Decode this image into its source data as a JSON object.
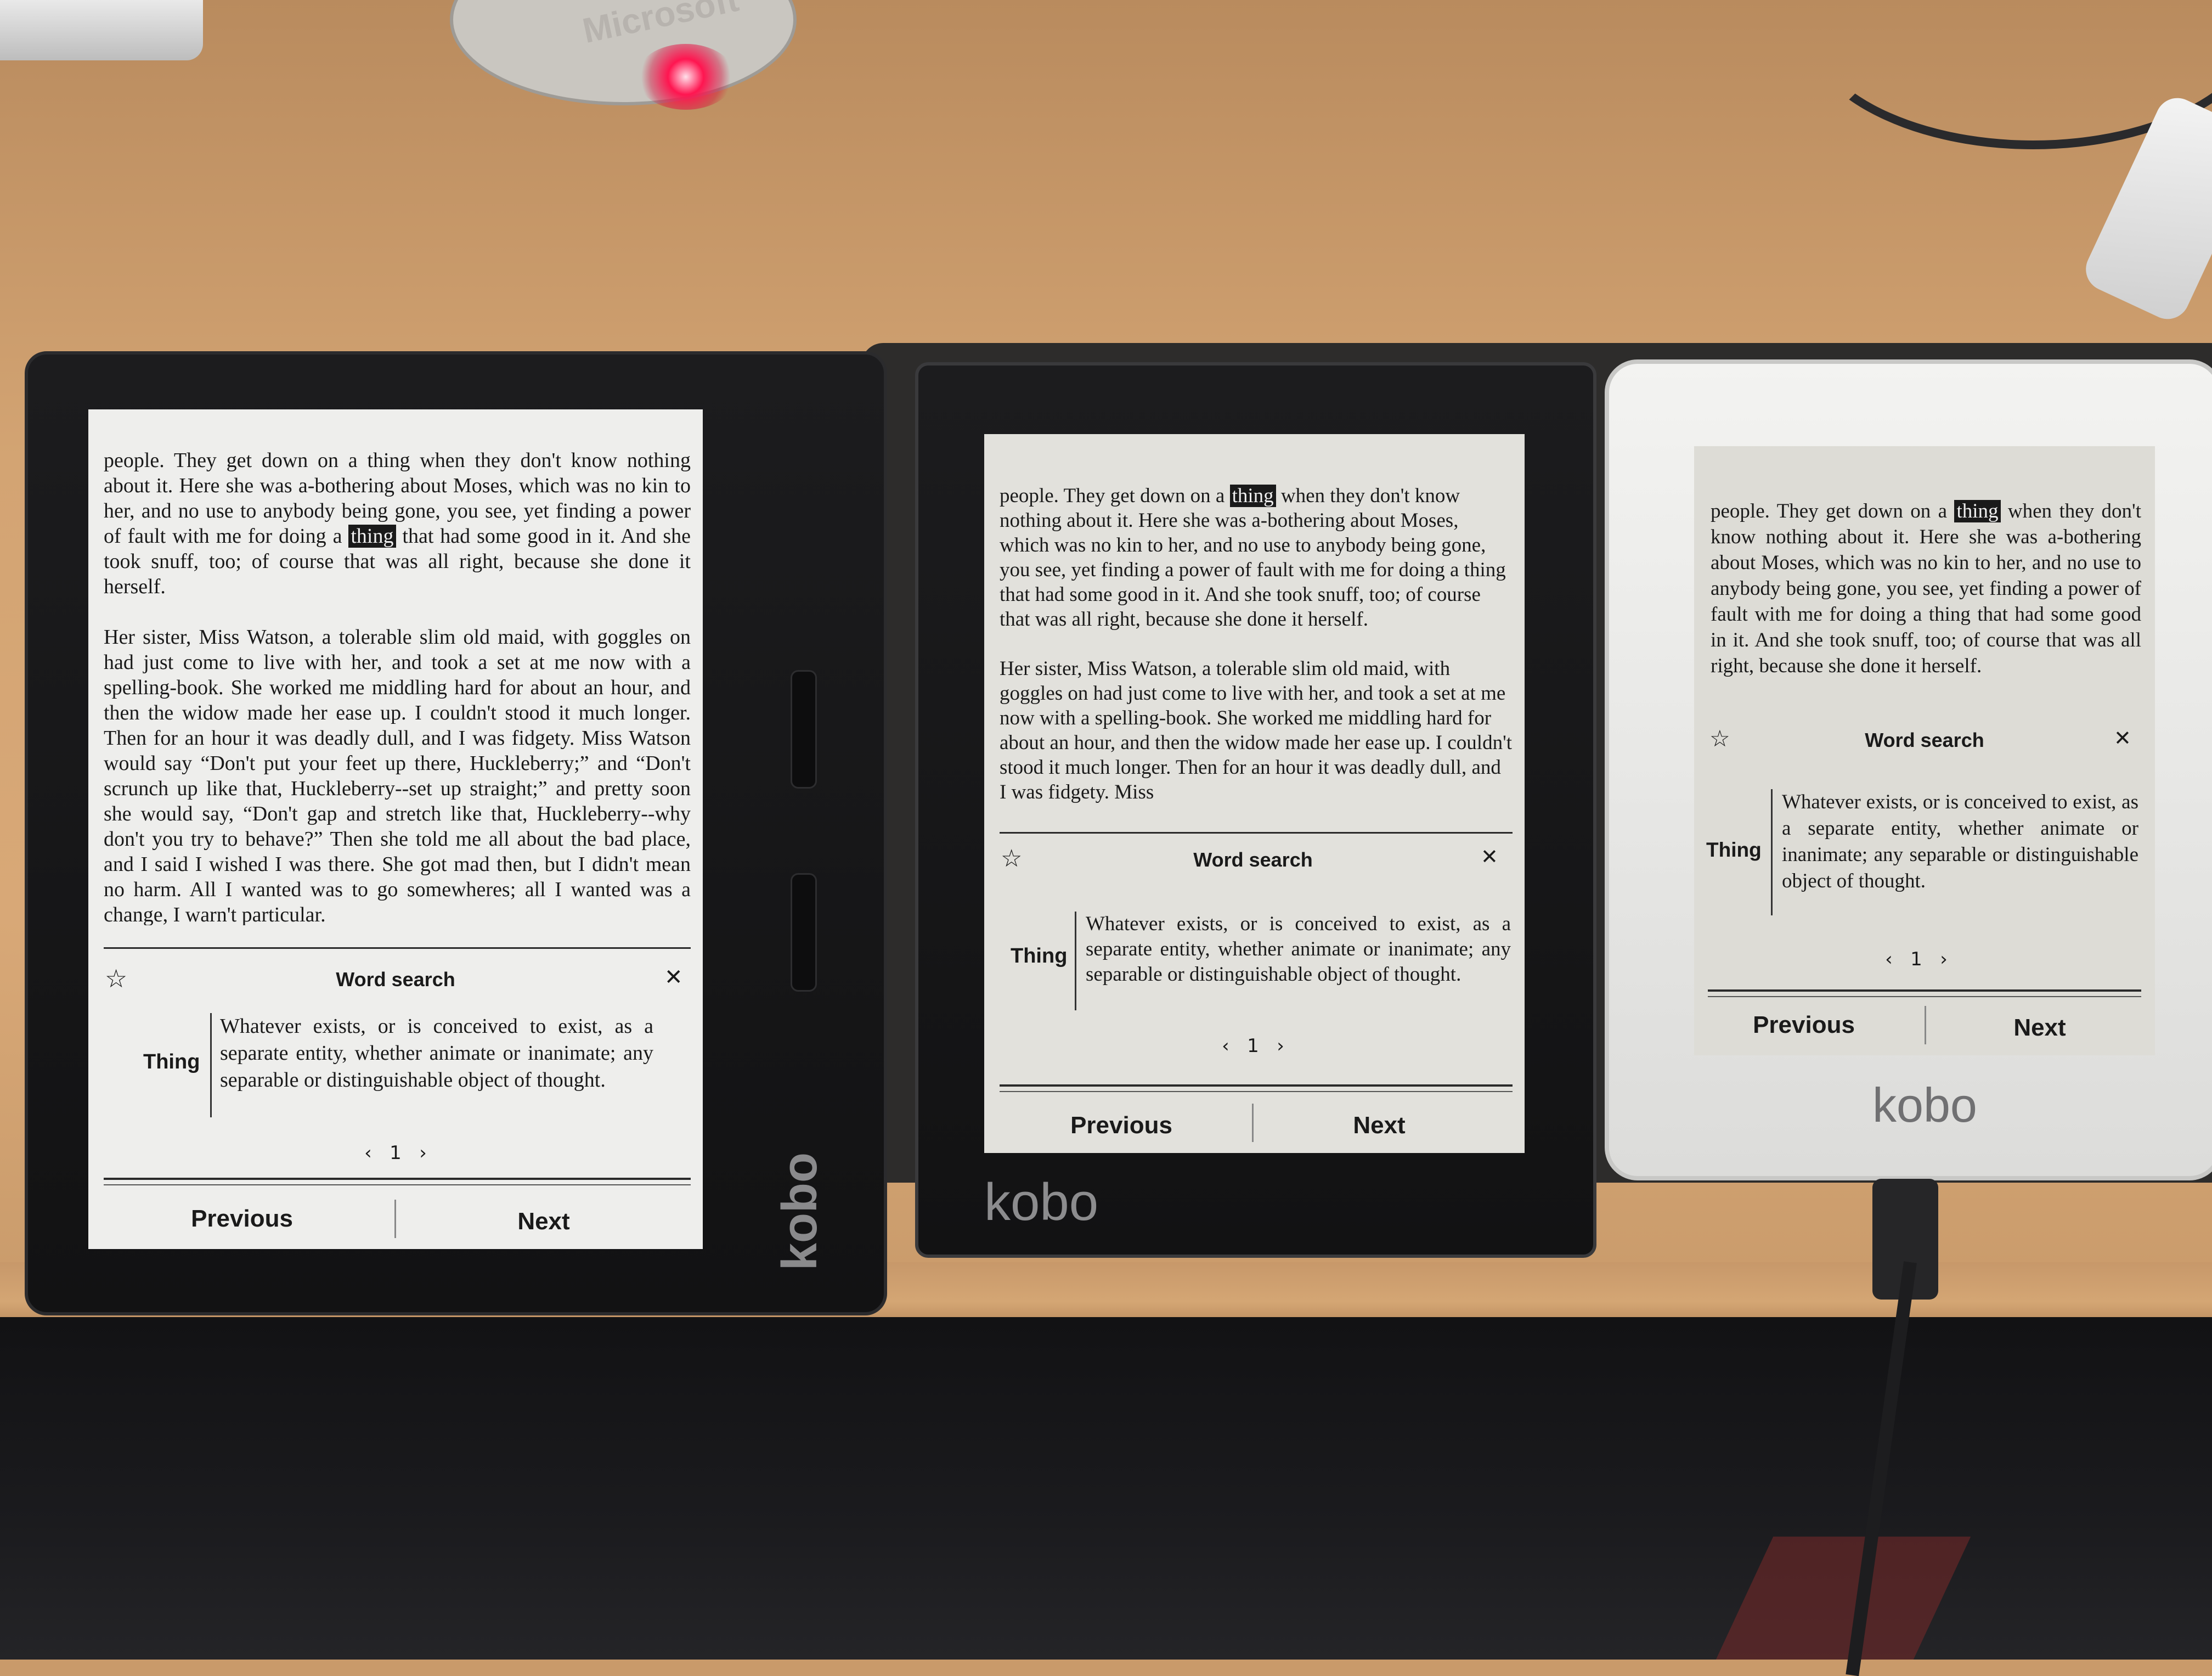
{
  "scene": {
    "mouse_brand": "Microsoft"
  },
  "devices": [
    {
      "logo": "kobo",
      "text_p1_before": "people. They get down on a thing when they don't know nothing about it. Here she was a-bothering about Moses, which was no kin to her, and no use to anybody being gone, you see, yet finding a power of fault with me for doing a ",
      "text_p1_highlight": "thing",
      "text_p1_after": " that had some good in it. And she took snuff, too; of course that was all right, because she done it herself.",
      "text_p2": "Her sister, Miss Watson, a tolerable slim old maid, with goggles on had just come to live with her, and took a set at me now with a spelling-book. She worked me middling hard for about an hour, and then the widow made her ease up. I couldn't stood it much longer. Then for an hour it was deadly dull, and I was fidgety. Miss Watson would say “Don't put your feet up there, Huckleberry;” and “Don't scrunch up like that, Huckleberry--set up straight;” and pretty soon she would say, “Don't gap and stretch like that, Huckleberry--why don't you try to behave?” Then she told me all about the bad place, and I said I wished I was there. She got mad then, but I didn't mean no harm. All I wanted was to go somewheres; all I wanted was a change, I warn't particular.",
      "word_search": {
        "title": "Word search",
        "star_icon": "☆",
        "close_icon": "✕",
        "term": "Thing",
        "definition": "Whatever exists, or is conceived to exist, as a separate entity, whether animate or inanimate; any separable or distinguishable object of thought.",
        "prev_arrow": "‹",
        "page": "1",
        "next_arrow": "›"
      },
      "nav": {
        "previous": "Previous",
        "next": "Next"
      }
    },
    {
      "logo": "kobo",
      "text_p1_before": "people. They get down on a ",
      "text_p1_highlight": "thing",
      "text_p1_after": " when they don't know nothing about it. Here she was a-bothering about Moses, which was no kin to her, and no use to anybody being gone, you see, yet finding a power of fault with me for doing a thing that had some good in it. And she took snuff, too; of course that was all right, because she done it herself.",
      "text_p2": "Her sister, Miss Watson, a tolerable slim old maid, with goggles on had just come to live with her, and took a set at me now with a spelling-book. She worked me middling hard for about an hour, and then the widow made her ease up. I couldn't stood it much longer. Then for an hour it was deadly dull, and I was fidgety. Miss",
      "word_search": {
        "title": "Word search",
        "star_icon": "☆",
        "close_icon": "✕",
        "term": "Thing",
        "definition": "Whatever exists, or is conceived to exist, as a separate entity, whether animate or inanimate; any separable or distinguishable object of thought.",
        "prev_arrow": "‹",
        "page": "1",
        "next_arrow": "›"
      },
      "nav": {
        "previous": "Previous",
        "next": "Next"
      }
    },
    {
      "logo": "kobo",
      "text_p1_before": "people. They get down on a ",
      "text_p1_highlight": "thing",
      "text_p1_after": " when they don't know nothing about it. Here she was a-bothering about Moses, which was no kin to her, and no use to anybody being gone, you see, yet finding a power of fault with me for doing a thing that had some good in it. And she took snuff, too; of course that was all right, because she done it herself.",
      "word_search": {
        "title": "Word search",
        "star_icon": "☆",
        "close_icon": "✕",
        "term": "Thing",
        "definition": "Whatever exists, or is conceived to exist, as a separate entity, whether animate or inanimate; any separable or distinguishable object of thought.",
        "prev_arrow": "‹",
        "page": "1",
        "next_arrow": "›"
      },
      "nav": {
        "previous": "Previous",
        "next": "Next"
      }
    }
  ]
}
